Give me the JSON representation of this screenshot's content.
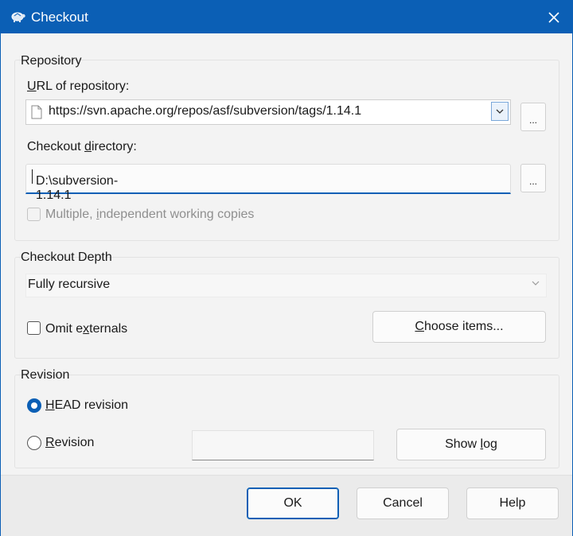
{
  "window": {
    "title": "Checkout",
    "accent_color": "#0b5fb5",
    "icons": {
      "app": "tortoise-icon",
      "close": "close-icon"
    }
  },
  "repository": {
    "group_label": "Repository",
    "url_label": "URL of repository:",
    "url_value": "https://svn.apache.org/repos/asf/subversion/tags/1.14.1",
    "url_browse_label": "...",
    "dir_label": "Checkout directory:",
    "dir_value": "D:\\subversion-1.14.1",
    "dir_browse_label": "...",
    "multiple_label": "Multiple, independent working copies",
    "multiple_checked": false,
    "multiple_enabled": false
  },
  "depth": {
    "group_label": "Checkout Depth",
    "selected": "Fully recursive",
    "omit_externals_label": "Omit externals",
    "omit_externals_checked": false,
    "choose_items_label": "Choose items..."
  },
  "revision": {
    "group_label": "Revision",
    "head_label": "HEAD revision",
    "head_selected": true,
    "revision_label": "Revision",
    "revision_value": "",
    "show_log_label": "Show log"
  },
  "footer": {
    "ok_label": "OK",
    "cancel_label": "Cancel",
    "help_label": "Help"
  }
}
